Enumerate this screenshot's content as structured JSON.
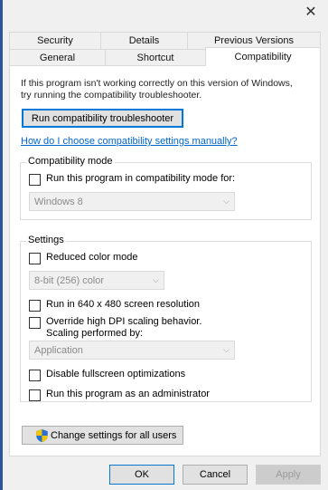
{
  "window": {
    "close_glyph": "✕"
  },
  "tabs_row1": [
    {
      "label": "Security"
    },
    {
      "label": "Details"
    },
    {
      "label": "Previous Versions"
    }
  ],
  "tabs_row2": [
    {
      "label": "General"
    },
    {
      "label": "Shortcut"
    },
    {
      "label": "Compatibility",
      "active": true
    }
  ],
  "intro": {
    "line1": "If this program isn't working correctly on this version of Windows,",
    "line2": "try running the compatibility troubleshooter."
  },
  "troubleshooter_button": "Run compatibility troubleshooter",
  "manual_link": "How do I choose compatibility settings manually?",
  "compat_mode": {
    "group_label": "Compatibility mode",
    "checkbox_label": "Run this program in compatibility mode for:",
    "checked": false,
    "os_value": "Windows 8"
  },
  "settings": {
    "group_label": "Settings",
    "reduced_color_label": "Reduced color mode",
    "color_value": "8-bit (256) color",
    "res_label": "Run in 640 x 480 screen resolution",
    "dpi_line1": "Override high DPI scaling behavior.",
    "dpi_line2": "Scaling performed by:",
    "dpi_value": "Application",
    "fullscreen_label": "Disable fullscreen optimizations",
    "admin_label": "Run this program as an administrator"
  },
  "change_all_users_button": "Change settings for all users",
  "dialog_buttons": {
    "ok": "OK",
    "cancel": "Cancel",
    "apply": "Apply"
  },
  "colors": {
    "link": "#0066cc",
    "accent": "#0078d7",
    "window_edge": "#2b579a"
  },
  "icons": {
    "shield": "uac-shield-icon",
    "close": "close-icon",
    "chevron": "chevron-down-icon"
  }
}
